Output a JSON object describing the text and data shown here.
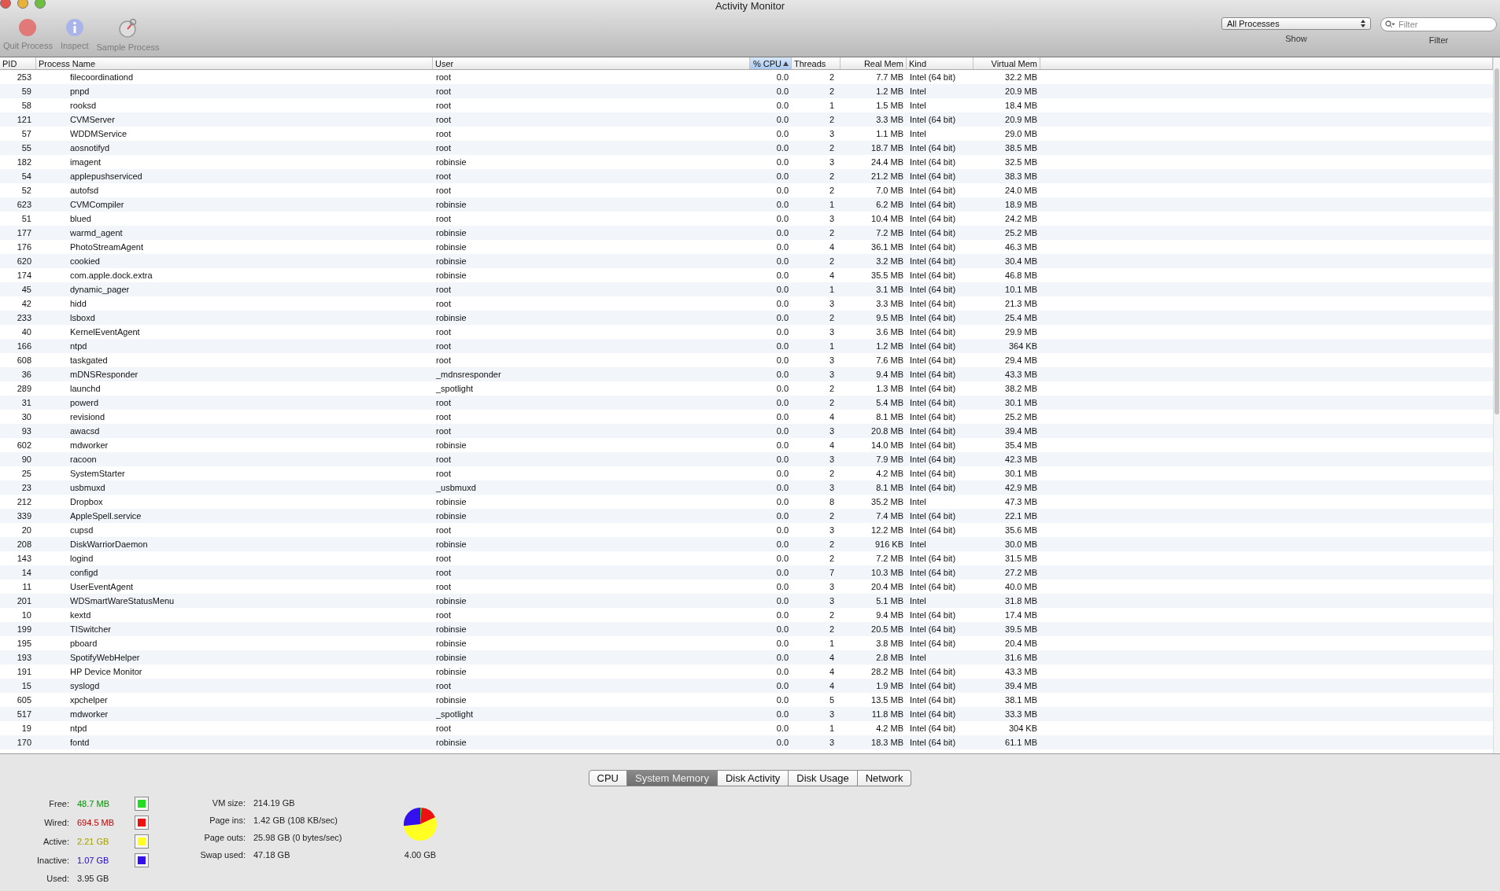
{
  "window": {
    "title": "Activity Monitor"
  },
  "toolbar": {
    "buttons": [
      {
        "kind": "quit",
        "label": "Quit Process",
        "disabled": true
      },
      {
        "kind": "inspect",
        "label": "Inspect",
        "disabled": true
      },
      {
        "kind": "sample",
        "label": "Sample Process",
        "disabled": true
      }
    ],
    "show": {
      "value": "All Processes",
      "label": "Show"
    },
    "filter": {
      "placeholder": "Filter",
      "label": "Filter"
    }
  },
  "table": {
    "columns": [
      {
        "label": "PID",
        "selected": false
      },
      {
        "label": "Process Name",
        "selected": false
      },
      {
        "label": "User",
        "selected": false
      },
      {
        "label": "% CPU",
        "selected": true
      },
      {
        "label": "Threads",
        "selected": false
      },
      {
        "label": "Real Mem",
        "selected": false
      },
      {
        "label": "Kind",
        "selected": false
      },
      {
        "label": "Virtual Mem",
        "selected": false
      }
    ],
    "rows": [
      [
        "253",
        "filecoordinationd",
        "root",
        "0.0",
        "2",
        "7.7 MB",
        "Intel (64 bit)",
        "32.2 MB"
      ],
      [
        "59",
        "pnpd",
        "root",
        "0.0",
        "2",
        "1.2 MB",
        "Intel",
        "20.9 MB"
      ],
      [
        "58",
        "rooksd",
        "root",
        "0.0",
        "1",
        "1.5 MB",
        "Intel",
        "18.4 MB"
      ],
      [
        "121",
        "CVMServer",
        "root",
        "0.0",
        "2",
        "3.3 MB",
        "Intel (64 bit)",
        "20.9 MB"
      ],
      [
        "57",
        "WDDMService",
        "root",
        "0.0",
        "3",
        "1.1 MB",
        "Intel",
        "29.0 MB"
      ],
      [
        "55",
        "aosnotifyd",
        "root",
        "0.0",
        "2",
        "18.7 MB",
        "Intel (64 bit)",
        "38.5 MB"
      ],
      [
        "182",
        "imagent",
        "robinsie",
        "0.0",
        "3",
        "24.4 MB",
        "Intel (64 bit)",
        "32.5 MB"
      ],
      [
        "54",
        "applepushserviced",
        "root",
        "0.0",
        "2",
        "21.2 MB",
        "Intel (64 bit)",
        "38.3 MB"
      ],
      [
        "52",
        "autofsd",
        "root",
        "0.0",
        "2",
        "7.0 MB",
        "Intel (64 bit)",
        "24.0 MB"
      ],
      [
        "623",
        "CVMCompiler",
        "robinsie",
        "0.0",
        "1",
        "6.2 MB",
        "Intel (64 bit)",
        "18.9 MB"
      ],
      [
        "51",
        "blued",
        "root",
        "0.0",
        "3",
        "10.4 MB",
        "Intel (64 bit)",
        "24.2 MB"
      ],
      [
        "177",
        "warmd_agent",
        "robinsie",
        "0.0",
        "2",
        "7.2 MB",
        "Intel (64 bit)",
        "25.2 MB"
      ],
      [
        "176",
        "PhotoStreamAgent",
        "robinsie",
        "0.0",
        "4",
        "36.1 MB",
        "Intel (64 bit)",
        "46.3 MB"
      ],
      [
        "620",
        "cookied",
        "robinsie",
        "0.0",
        "2",
        "3.2 MB",
        "Intel (64 bit)",
        "30.4 MB"
      ],
      [
        "174",
        "com.apple.dock.extra",
        "robinsie",
        "0.0",
        "4",
        "35.5 MB",
        "Intel (64 bit)",
        "46.8 MB"
      ],
      [
        "45",
        "dynamic_pager",
        "root",
        "0.0",
        "1",
        "3.1 MB",
        "Intel (64 bit)",
        "10.1 MB"
      ],
      [
        "42",
        "hidd",
        "root",
        "0.0",
        "3",
        "3.3 MB",
        "Intel (64 bit)",
        "21.3 MB"
      ],
      [
        "233",
        "lsboxd",
        "robinsie",
        "0.0",
        "2",
        "9.5 MB",
        "Intel (64 bit)",
        "25.4 MB"
      ],
      [
        "40",
        "KernelEventAgent",
        "root",
        "0.0",
        "3",
        "3.6 MB",
        "Intel (64 bit)",
        "29.9 MB"
      ],
      [
        "166",
        "ntpd",
        "root",
        "0.0",
        "1",
        "1.2 MB",
        "Intel (64 bit)",
        "364 KB"
      ],
      [
        "608",
        "taskgated",
        "root",
        "0.0",
        "3",
        "7.6 MB",
        "Intel (64 bit)",
        "29.4 MB"
      ],
      [
        "36",
        "mDNSResponder",
        "_mdnsresponder",
        "0.0",
        "3",
        "9.4 MB",
        "Intel (64 bit)",
        "43.3 MB"
      ],
      [
        "289",
        "launchd",
        "_spotlight",
        "0.0",
        "2",
        "1.3 MB",
        "Intel (64 bit)",
        "38.2 MB"
      ],
      [
        "31",
        "powerd",
        "root",
        "0.0",
        "2",
        "5.4 MB",
        "Intel (64 bit)",
        "30.1 MB"
      ],
      [
        "30",
        "revisiond",
        "root",
        "0.0",
        "4",
        "8.1 MB",
        "Intel (64 bit)",
        "25.2 MB"
      ],
      [
        "93",
        "awacsd",
        "root",
        "0.0",
        "3",
        "20.8 MB",
        "Intel (64 bit)",
        "39.4 MB"
      ],
      [
        "602",
        "mdworker",
        "robinsie",
        "0.0",
        "4",
        "14.0 MB",
        "Intel (64 bit)",
        "35.4 MB"
      ],
      [
        "90",
        "racoon",
        "root",
        "0.0",
        "3",
        "7.9 MB",
        "Intel (64 bit)",
        "42.3 MB"
      ],
      [
        "25",
        "SystemStarter",
        "root",
        "0.0",
        "2",
        "4.2 MB",
        "Intel (64 bit)",
        "30.1 MB"
      ],
      [
        "23",
        "usbmuxd",
        "_usbmuxd",
        "0.0",
        "3",
        "8.1 MB",
        "Intel (64 bit)",
        "42.9 MB"
      ],
      [
        "212",
        "Dropbox",
        "robinsie",
        "0.0",
        "8",
        "35.2 MB",
        "Intel",
        "47.3 MB"
      ],
      [
        "339",
        "AppleSpell.service",
        "robinsie",
        "0.0",
        "2",
        "7.4 MB",
        "Intel (64 bit)",
        "22.1 MB"
      ],
      [
        "20",
        "cupsd",
        "root",
        "0.0",
        "3",
        "12.2 MB",
        "Intel (64 bit)",
        "35.6 MB"
      ],
      [
        "208",
        "DiskWarriorDaemon",
        "robinsie",
        "0.0",
        "2",
        "916 KB",
        "Intel",
        "30.0 MB"
      ],
      [
        "143",
        "logind",
        "root",
        "0.0",
        "2",
        "7.2 MB",
        "Intel (64 bit)",
        "31.5 MB"
      ],
      [
        "14",
        "configd",
        "root",
        "0.0",
        "7",
        "10.3 MB",
        "Intel (64 bit)",
        "27.2 MB"
      ],
      [
        "11",
        "UserEventAgent",
        "root",
        "0.0",
        "3",
        "20.4 MB",
        "Intel (64 bit)",
        "40.0 MB"
      ],
      [
        "201",
        "WDSmartWareStatusMenu",
        "robinsie",
        "0.0",
        "3",
        "5.1 MB",
        "Intel",
        "31.8 MB"
      ],
      [
        "10",
        "kextd",
        "root",
        "0.0",
        "2",
        "9.4 MB",
        "Intel (64 bit)",
        "17.4 MB"
      ],
      [
        "199",
        "TISwitcher",
        "robinsie",
        "0.0",
        "2",
        "20.5 MB",
        "Intel (64 bit)",
        "39.5 MB"
      ],
      [
        "195",
        "pboard",
        "robinsie",
        "0.0",
        "1",
        "3.8 MB",
        "Intel (64 bit)",
        "20.4 MB"
      ],
      [
        "193",
        "SpotifyWebHelper",
        "robinsie",
        "0.0",
        "4",
        "2.8 MB",
        "Intel",
        "31.6 MB"
      ],
      [
        "191",
        "HP Device Monitor",
        "robinsie",
        "0.0",
        "4",
        "28.2 MB",
        "Intel (64 bit)",
        "43.3 MB"
      ],
      [
        "15",
        "syslogd",
        "root",
        "0.0",
        "4",
        "1.9 MB",
        "Intel (64 bit)",
        "39.4 MB"
      ],
      [
        "605",
        "xpchelper",
        "robinsie",
        "0.0",
        "5",
        "13.5 MB",
        "Intel (64 bit)",
        "38.1 MB"
      ],
      [
        "517",
        "mdworker",
        "_spotlight",
        "0.0",
        "3",
        "11.8 MB",
        "Intel (64 bit)",
        "33.3 MB"
      ],
      [
        "19",
        "ntpd",
        "root",
        "0.0",
        "1",
        "4.2 MB",
        "Intel (64 bit)",
        "304 KB"
      ],
      [
        "170",
        "fontd",
        "robinsie",
        "0.0",
        "3",
        "18.3 MB",
        "Intel (64 bit)",
        "61.1 MB"
      ]
    ]
  },
  "bottom_tabs": [
    {
      "label": "CPU",
      "selected": false
    },
    {
      "label": "System Memory",
      "selected": true
    },
    {
      "label": "Disk Activity",
      "selected": false
    },
    {
      "label": "Disk Usage",
      "selected": false
    },
    {
      "label": "Network",
      "selected": false
    }
  ],
  "memory": {
    "items": [
      {
        "label": "Free:",
        "value": "48.7 MB",
        "color": "#22dd22"
      },
      {
        "label": "Wired:",
        "value": "694.5 MB",
        "color": "#ee1111"
      },
      {
        "label": "Active:",
        "value": "2.21 GB",
        "color": "#ffff22"
      },
      {
        "label": "Inactive:",
        "value": "1.07 GB",
        "color": "#3311ee"
      }
    ],
    "used": {
      "label": "Used:",
      "value": "3.95 GB"
    },
    "vm": [
      {
        "label": "VM size:",
        "value": "214.19 GB"
      },
      {
        "label": "Page ins:",
        "value": "1.42 GB (108 KB/sec)"
      },
      {
        "label": "Page outs:",
        "value": "25.98 GB (0 bytes/sec)"
      },
      {
        "label": "Swap used:",
        "value": "47.18 GB"
      }
    ],
    "total": "4.00 GB"
  }
}
